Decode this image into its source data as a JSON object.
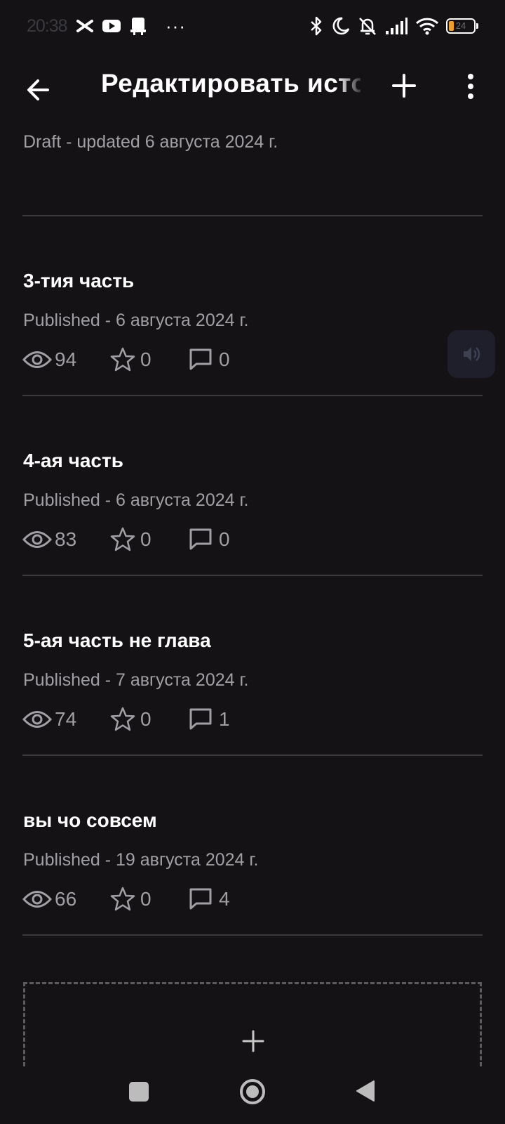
{
  "status_bar": {
    "time": "20:38",
    "dots": "···",
    "battery_level": "24"
  },
  "app_bar": {
    "title": "Редактировать история"
  },
  "draft": {
    "status": "Draft - updated 6 августа 2024 г."
  },
  "parts": [
    {
      "title": "3-тия часть",
      "status": "Published - 6 августа 2024 г.",
      "views": "94",
      "stars": "0",
      "comments": "0"
    },
    {
      "title": "4-ая часть",
      "status": "Published - 6 августа 2024 г.",
      "views": "83",
      "stars": "0",
      "comments": "0"
    },
    {
      "title": "5-ая  часть не глава",
      "status": "Published - 7 августа 2024 г.",
      "views": "74",
      "stars": "0",
      "comments": "1"
    },
    {
      "title": "вы чо совсем",
      "status": "Published - 19 августа 2024 г.",
      "views": "66",
      "stars": "0",
      "comments": "4"
    }
  ],
  "colors": {
    "background": "#141215",
    "text_primary": "#ffffff",
    "text_secondary": "#a0a0a4",
    "divider": "#3b3a3f"
  }
}
